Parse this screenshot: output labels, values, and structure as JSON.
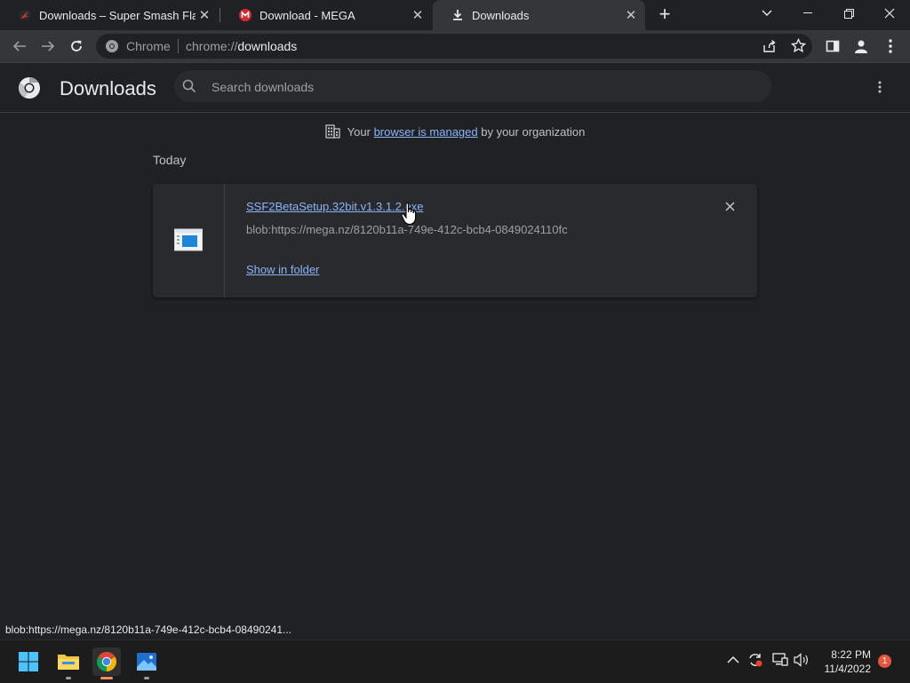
{
  "tabs": [
    {
      "title": "Downloads – Super Smash Flash",
      "close": "✕"
    },
    {
      "title": "Download - MEGA",
      "close": "✕"
    },
    {
      "title": "Downloads",
      "close": "✕"
    }
  ],
  "omnibox": {
    "site_label": "Chrome",
    "url_prefix": "chrome://",
    "url_main": "downloads"
  },
  "page": {
    "title": "Downloads",
    "search_placeholder": "Search downloads",
    "managed_prefix": "Your ",
    "managed_link": "browser is managed",
    "managed_suffix": " by your organization",
    "date_group": "Today"
  },
  "download": {
    "filename": "SSF2BetaSetup.32bit.v1.3.1.2.exe",
    "source": "blob:https://mega.nz/8120b11a-749e-412c-bcb4-0849024110fc",
    "action": "Show in folder"
  },
  "status_bar": "blob:https://mega.nz/8120b11a-749e-412c-bcb4-08490241...",
  "taskbar": {
    "time": "8:22 PM",
    "date": "11/4/2022",
    "notifications": "1"
  },
  "colors": {
    "accent": "#8ab4f8",
    "background": "#202124",
    "card": "#292a2d"
  },
  "icons": [
    "smash-flash-favicon",
    "mega-favicon",
    "download-favicon",
    "chrome-logo",
    "search-icon",
    "building-icon",
    "file-icon",
    "windows-start-icon",
    "file-explorer-icon",
    "chrome-icon",
    "photos-icon"
  ]
}
